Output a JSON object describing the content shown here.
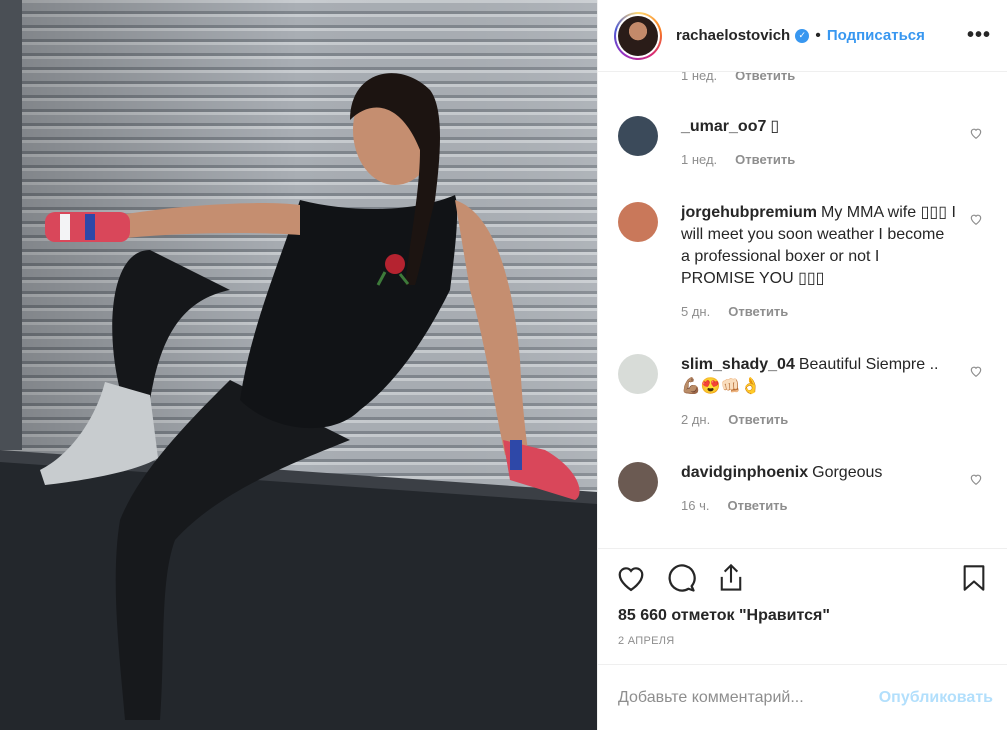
{
  "post": {
    "username": "rachaelostovich",
    "follow_label": "Подписаться",
    "dot": "•",
    "more": "•••",
    "likes": "85 660 отметок \"Нравится\"",
    "date": "2 АПРЕЛЯ"
  },
  "comments_top_meta": {
    "time": "1 нед.",
    "reply": "Ответить"
  },
  "comments": [
    {
      "user": "_umar_oo7",
      "text": "▯",
      "time": "1 нед.",
      "reply": "Ответить",
      "avatar_color": "#3b4a5a"
    },
    {
      "user": "jorgehubpremium",
      "text": "My MMA wife ▯▯▯ I will meet you soon weather I become a professional boxer or not I PROMISE YOU ▯▯▯",
      "time": "5 дн.",
      "reply": "Ответить",
      "avatar_color": "#c9785a"
    },
    {
      "user": "slim_shady_04",
      "text": "Beautiful Siempre .. 💪🏽😍👊🏻👌",
      "time": "2 дн.",
      "reply": "Ответить",
      "avatar_color": "#d8dcd8"
    },
    {
      "user": "davidginphoenix",
      "text": "Gorgeous",
      "time": "16 ч.",
      "reply": "Ответить",
      "avatar_color": "#6b5a52"
    }
  ],
  "add_comment": {
    "placeholder": "Добавьте комментарий...",
    "publish": "Опубликовать"
  },
  "colors": {
    "accent": "#3897f0",
    "publish_disabled": "#b2dffc",
    "muted": "#8e8e8e"
  },
  "icons": [
    "heart-icon",
    "comment-icon",
    "share-icon",
    "bookmark-icon",
    "verified-icon",
    "more-icon"
  ]
}
